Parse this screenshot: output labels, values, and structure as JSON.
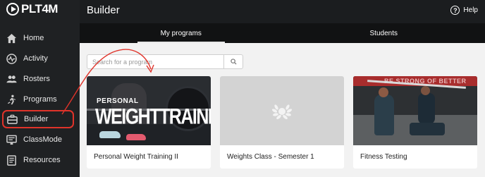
{
  "brand": {
    "logo_text": "PLT4M"
  },
  "header": {
    "title": "Builder",
    "help_label": "Help",
    "help_icon": "question-circle-icon"
  },
  "sidebar": {
    "items": [
      {
        "label": "Home",
        "icon": "home-icon"
      },
      {
        "label": "Activity",
        "icon": "activity-icon"
      },
      {
        "label": "Rosters",
        "icon": "rosters-icon"
      },
      {
        "label": "Programs",
        "icon": "programs-icon"
      },
      {
        "label": "Builder",
        "icon": "builder-icon",
        "active": true
      },
      {
        "label": "ClassMode",
        "icon": "classmode-icon"
      },
      {
        "label": "Resources",
        "icon": "resources-icon"
      }
    ],
    "highlight_color": "#e0332a"
  },
  "tabs": [
    {
      "label": "My programs",
      "active": true
    },
    {
      "label": "Students",
      "active": false
    }
  ],
  "search": {
    "placeholder": "Search for a program",
    "value": "",
    "icon": "search-icon"
  },
  "cards": [
    {
      "title": "Personal Weight Training II",
      "image_line1": "PERSONAL",
      "image_line2": "WEIGHTTRAINING"
    },
    {
      "title": "Weights Class - Semester 1",
      "image_icon": "laurel-icon"
    },
    {
      "title": "Fitness Testing",
      "image_banner": "BE STRONG OF BETTER"
    }
  ],
  "annotation": {
    "color": "#e0332a",
    "icon": "curved-arrow-icon"
  }
}
